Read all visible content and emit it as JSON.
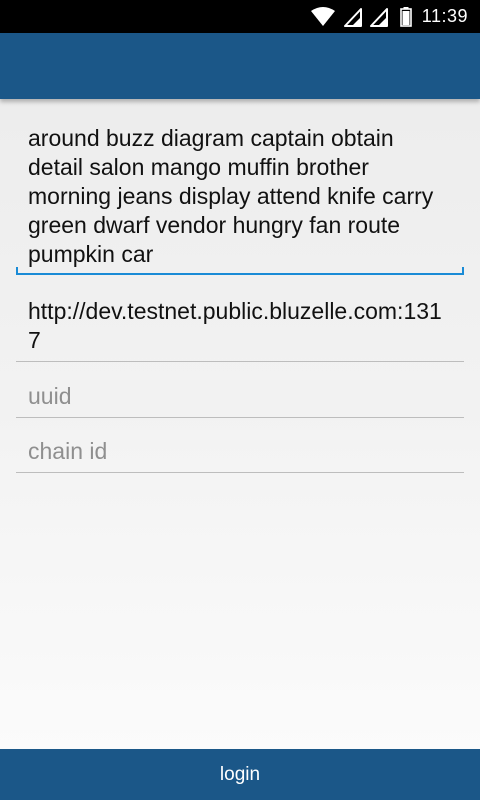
{
  "status_bar": {
    "time": "11:39",
    "icons": [
      "wifi-icon",
      "signal-icon",
      "signal-icon",
      "battery-icon"
    ]
  },
  "app_bar": {
    "color": "#1b5788"
  },
  "form": {
    "mnemonic": {
      "value": "around buzz diagram captain obtain detail salon mango muffin brother morning jeans display attend knife carry green dwarf vendor hungry fan route pumpkin car"
    },
    "endpoint": {
      "value": "http://dev.testnet.public.bluzelle.com:1317"
    },
    "uuid": {
      "placeholder": "uuid"
    },
    "chain_id": {
      "placeholder": "chain id"
    }
  },
  "login_button": {
    "label": "login"
  },
  "colors": {
    "accent": "#1a8bd6",
    "primary": "#1b5788"
  }
}
